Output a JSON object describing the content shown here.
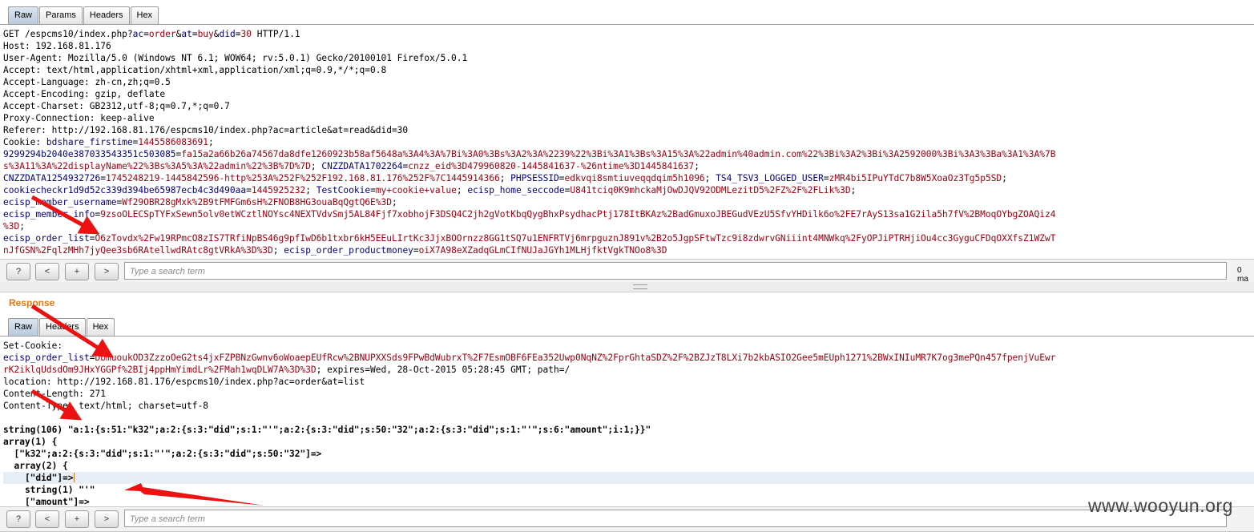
{
  "request": {
    "tabs": [
      "Raw",
      "Params",
      "Headers",
      "Hex"
    ],
    "lines": [
      [
        {
          "t": "GET /espcms10/index.php?"
        },
        {
          "t": "ac",
          "c": "k"
        },
        {
          "t": "="
        },
        {
          "t": "order",
          "c": "v"
        },
        {
          "t": "&"
        },
        {
          "t": "at",
          "c": "k"
        },
        {
          "t": "="
        },
        {
          "t": "buy",
          "c": "v"
        },
        {
          "t": "&"
        },
        {
          "t": "did",
          "c": "k"
        },
        {
          "t": "="
        },
        {
          "t": "30",
          "c": "v"
        },
        {
          "t": " HTTP/1.1"
        }
      ],
      [
        {
          "t": "Host: 192.168.81.176"
        }
      ],
      [
        {
          "t": "User-Agent: Mozilla/5.0 (Windows NT 6.1; WOW64; rv:5.0.1) Gecko/20100101 Firefox/5.0.1"
        }
      ],
      [
        {
          "t": "Accept: text/html,application/xhtml+xml,application/xml;q=0.9,*/*;q=0.8"
        }
      ],
      [
        {
          "t": "Accept-Language: zh-cn,zh;q=0.5"
        }
      ],
      [
        {
          "t": "Accept-Encoding: gzip, deflate"
        }
      ],
      [
        {
          "t": "Accept-Charset: GB2312,utf-8;q=0.7,*;q=0.7"
        }
      ],
      [
        {
          "t": "Proxy-Connection: keep-alive"
        }
      ],
      [
        {
          "t": "Referer: http://192.168.81.176/espcms10/index.php?ac=article&at=read&did=30"
        }
      ],
      [
        {
          "t": "Cookie: "
        },
        {
          "t": "bdshare_firstime",
          "c": "k"
        },
        {
          "t": "="
        },
        {
          "t": "1445586083691",
          "c": "v"
        },
        {
          "t": ";"
        }
      ],
      [
        {
          "t": "9299294b2040e387033543351c503085",
          "c": "k"
        },
        {
          "t": "="
        },
        {
          "t": "fa15a2a66b26a74567da8dfe1260923b58af5648a%3A4%3A%7Bi%3A0%3Bs%3A2%3A%2239%22%3Bi%3A1%3Bs%3A15%3A%22admin%40admin.com%22%3Bi%3A2%3Bi%3A2592000%3Bi%3A3%3Ba%3A1%3A%7B",
          "c": "v"
        }
      ],
      [
        {
          "t": "s%3A11%3A%22displayName%22%3Bs%3A5%3A%22admin%22%3B%7D%7D",
          "c": "v"
        },
        {
          "t": "; "
        },
        {
          "t": "CNZZDATA1702264",
          "c": "k"
        },
        {
          "t": "="
        },
        {
          "t": "cnzz_eid%3D479960820-1445841637-%26ntime%3D1445841637",
          "c": "v"
        },
        {
          "t": ";"
        }
      ],
      [
        {
          "t": "CNZZDATA1254932726",
          "c": "k"
        },
        {
          "t": "="
        },
        {
          "t": "1745248219-1445842596-http%253A%252F%252F192.168.81.176%252F%7C1445914366",
          "c": "v"
        },
        {
          "t": "; "
        },
        {
          "t": "PHPSESSID",
          "c": "k"
        },
        {
          "t": "="
        },
        {
          "t": "edkvqi8smtiuveqqdqim5h1096",
          "c": "v"
        },
        {
          "t": "; "
        },
        {
          "t": "TS4_TSV3_LOGGED_USER",
          "c": "k"
        },
        {
          "t": "="
        },
        {
          "t": "zMR4bi5IPuYTdC7b8W5XoaOz3Tg5p5SD",
          "c": "v"
        },
        {
          "t": ";"
        }
      ],
      [
        {
          "t": "cookiecheckr1d9d52c339d394be65987ecb4c3d490aa",
          "c": "k"
        },
        {
          "t": "="
        },
        {
          "t": "1445925232",
          "c": "v"
        },
        {
          "t": "; "
        },
        {
          "t": "TestCookie",
          "c": "k"
        },
        {
          "t": "="
        },
        {
          "t": "my+cookie+value",
          "c": "v"
        },
        {
          "t": "; "
        },
        {
          "t": "ecisp_home_seccode",
          "c": "k"
        },
        {
          "t": "="
        },
        {
          "t": "U841tciq0K9mhckaMjOwDJQV92ODMLezitD5%2FZ%2F%2FLik%3D",
          "c": "v"
        },
        {
          "t": ";"
        }
      ],
      [
        {
          "t": "ecisp_member_username",
          "c": "k"
        },
        {
          "t": "="
        },
        {
          "t": "Wf29OBR28gMxk%2B9tFMFGm6sH%2FNOB8HG3ouaBqQgtQ6E%3D",
          "c": "v"
        },
        {
          "t": ";"
        }
      ],
      [
        {
          "t": "ecisp_member_info",
          "c": "k"
        },
        {
          "t": "="
        },
        {
          "t": "9zsoOLECSpTYFxSewn5olv0etWCztlNOYsc4NEXTVdvSmj5AL84Fjf7xobhojF3DSQ4C2jh2gVotKbqQygBhxPsydhacPtj178ItBKAz%2BadGmuxoJBEGudVEzU5SfvYHDilk6o%2FE7rAyS13sa1G2ila5h7fV%2BMoqOYbgZOAQiz4",
          "c": "v"
        }
      ],
      [
        {
          "t": "%3D",
          "c": "v"
        },
        {
          "t": ";"
        }
      ],
      [
        {
          "t": "ecisp_order_list",
          "c": "k"
        },
        {
          "t": "="
        },
        {
          "t": "O6zTovdx%2Fw19RPmcO8zIS7TRfiNpBS46g9pfIwD6b1txbr6kH5EEuLIrtKc3JjxBOOrnzz8GG1tSQ7u1ENFRTVj6mrpguznJ891v%2B2o5JgpSFtwTzc9i8zdwrvGNiiint4MNWkq%2FyOPJiPTRHjiOu4cc3GyguCFDqOXXfsZ1WZwT",
          "c": "v"
        }
      ],
      [
        {
          "t": "nJfGSN%2FqlzMHh7jyQee3sb6RAtellwdRAtc8gtVRkA%3D%3D",
          "c": "v"
        },
        {
          "t": "; "
        },
        {
          "t": "ecisp_order_productmoney",
          "c": "k"
        },
        {
          "t": "="
        },
        {
          "t": "oiX7A98eXZadqGLmCIfNUJaJGYh1MLHjfktVgkTNOo8%3D",
          "c": "v"
        }
      ]
    ]
  },
  "search": {
    "buttons": [
      "?",
      "<",
      "+",
      ">"
    ],
    "placeholder": "Type a search term",
    "matches_label": "0 ma"
  },
  "response": {
    "title": "Response",
    "tabs": [
      "Raw",
      "Headers",
      "Hex"
    ],
    "lines": [
      [
        {
          "t": "Set-Cookie:"
        }
      ],
      [
        {
          "t": "ecisp_order_list",
          "c": "k"
        },
        {
          "t": "="
        },
        {
          "t": "DbmuoukOD3ZzzoOeG2ts4jxFZPBNzGwnv6oWoaepEUfRcw%2BNUPXXSds9FPwBdWubrxT%2F7EsmOBF6FEa352Uwp0NqNZ%2FprGhtaSDZ%2F%2BZJzT8LXi7b2kbASIO2Gee5mEUph1271%2BWxINIuMR7K7og3mePQn457fpenjVuEwr",
          "c": "v"
        }
      ],
      [
        {
          "t": "rK2iklqUdsdOm9JHxYGGPf%2BIj4ppHmYimdLr%2FMah1wqDLW7A%3D%3D",
          "c": "v"
        },
        {
          "t": "; expires=Wed, 28-Oct-2015 05:28:45 GMT; path=/"
        }
      ],
      [
        {
          "t": "location: http://192.168.81.176/espcms10/index.php?ac=order&at=list"
        }
      ],
      [
        {
          "t": "Content-Length: 271"
        }
      ],
      [
        {
          "t": "Content-Type: text/html; charset=utf-8"
        }
      ],
      [
        {
          "t": ""
        }
      ],
      [
        {
          "t": "string(106) \"a:1:{s:51:\"k32\";a:2:{s:3:\"did\";s:1:\"'\";a:2:{s:3:\"did\";s:50:\"32\";a:2:{s:3:\"did\";s:1:\"'\";s:6:\"amount\";i:1;}}\"",
          "c": "b"
        }
      ],
      [
        {
          "t": "array(1) {",
          "c": "b"
        }
      ],
      [
        {
          "t": "  [\"k32\";a:2:{s:3:\"did\";s:1:\"'\";a:2:{s:3:\"did\";s:50:\"32\"]=>",
          "c": "b"
        }
      ],
      [
        {
          "t": "  array(2) {",
          "c": "b"
        }
      ],
      [
        {
          "t": "    [\"did\"]=>",
          "c": "b"
        }
      ],
      [
        {
          "t": "    string(1) \"'\"",
          "c": "b"
        }
      ],
      [
        {
          "t": "    [\"amount\"]=>",
          "c": "b"
        }
      ]
    ]
  },
  "watermark": "www.wooyun.org",
  "colors": {
    "key": "#000080",
    "value": "#a0000f",
    "accent": "#e07a18",
    "arrow": "#ee1111"
  }
}
